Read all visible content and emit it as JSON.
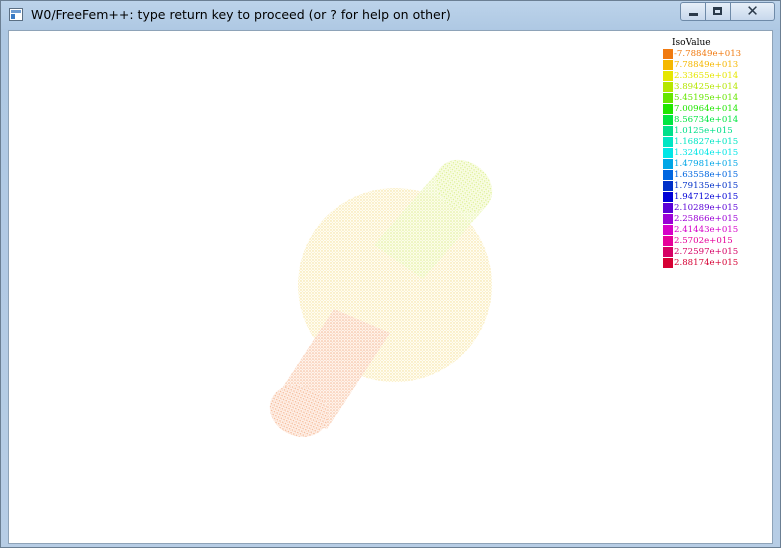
{
  "window": {
    "title": "W0/FreeFem++: type return key to proceed (or ? for help on other)",
    "minimize_label": "",
    "maximize_label": "",
    "close_label": "✕"
  },
  "legend": {
    "title": "IsoValue",
    "items": [
      {
        "label": "-7.78849e+013",
        "color": "#f07a10"
      },
      {
        "label": "7.78849e+013",
        "color": "#f5b800"
      },
      {
        "label": "2.33655e+014",
        "color": "#e6e600"
      },
      {
        "label": "3.89425e+014",
        "color": "#b5e600"
      },
      {
        "label": "5.45195e+014",
        "color": "#66e600"
      },
      {
        "label": "7.00964e+014",
        "color": "#1fe600"
      },
      {
        "label": "8.56734e+014",
        "color": "#00e640"
      },
      {
        "label": "1.0125e+015",
        "color": "#00e08a"
      },
      {
        "label": "1.16827e+015",
        "color": "#00e6c4"
      },
      {
        "label": "1.32404e+015",
        "color": "#00e6e6"
      },
      {
        "label": "1.47981e+015",
        "color": "#00a6e6"
      },
      {
        "label": "1.63558e+015",
        "color": "#0066e0"
      },
      {
        "label": "1.79135e+015",
        "color": "#0030c8"
      },
      {
        "label": "1.94712e+015",
        "color": "#0000d6"
      },
      {
        "label": "2.10289e+015",
        "color": "#5a00d6"
      },
      {
        "label": "2.25866e+015",
        "color": "#9a00d6"
      },
      {
        "label": "2.41443e+015",
        "color": "#d600c8"
      },
      {
        "label": "2.5702e+015",
        "color": "#e6009a"
      },
      {
        "label": "2.72597e+015",
        "color": "#d60064"
      },
      {
        "label": "2.88174e+015",
        "color": "#d60034"
      }
    ]
  },
  "plot": {
    "sphere_color": "#fdf0b0",
    "upper_cylinder_color": "#e8f7a8",
    "lower_cylinder_color": "#f8c6a8"
  }
}
